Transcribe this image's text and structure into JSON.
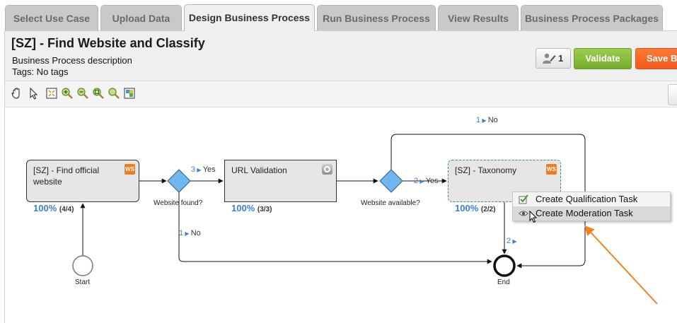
{
  "tabs": [
    {
      "label": "Select Use Case"
    },
    {
      "label": "Upload Data"
    },
    {
      "label": "Design Business Process"
    },
    {
      "label": "Run Business Process"
    },
    {
      "label": "View Results"
    },
    {
      "label": "Business Process Packages"
    }
  ],
  "active_tab": "Design Business Process",
  "header": {
    "title": "[SZ] - Find Website and Classify",
    "description": "Business Process description",
    "tags": "Tags: No tags",
    "editors_count": "1",
    "validate_label": "Validate",
    "save_label": "Save Bu"
  },
  "toolbar": {
    "icons": [
      "pan-icon",
      "select-icon",
      "fit-to-screen-icon",
      "zoom-in-icon",
      "zoom-out-icon",
      "zoom-area-icon",
      "zoom-reset-icon",
      "overview-icon"
    ]
  },
  "diagram": {
    "tasks": [
      {
        "label": "[SZ] - Find official website",
        "badge": "WS",
        "progress": "100%",
        "progress_frac": "(4/4)"
      },
      {
        "label": "URL Validation",
        "badge": "gear",
        "progress": "100%",
        "progress_frac": "(3/3)"
      },
      {
        "label": "[SZ] - Taxonomy",
        "badge": "WS",
        "progress": "100%",
        "progress_frac": "(2/2)"
      }
    ],
    "gateways": [
      {
        "label": "Website found?"
      },
      {
        "label": "Website available?"
      }
    ],
    "events": {
      "start": "Start",
      "end": "End"
    },
    "flows": [
      {
        "count": "3",
        "label": "Yes"
      },
      {
        "count": "1",
        "label": "No"
      },
      {
        "count": "2",
        "label": "Yes"
      },
      {
        "count": "1",
        "label": "No"
      },
      {
        "count": "2",
        "label": ""
      }
    ]
  },
  "context_menu": {
    "items": [
      {
        "label": "Create Qualification Task",
        "icon": "check-icon"
      },
      {
        "label": "Create Moderation Task",
        "icon": "eye-icon"
      }
    ]
  },
  "colors": {
    "accent_blue": "#3a80d0",
    "validate_green": "#8cc03f",
    "save_orange": "#ff6a2a",
    "annotation_orange": "#f5821f",
    "gateway_blue": "#6fb7ee"
  }
}
